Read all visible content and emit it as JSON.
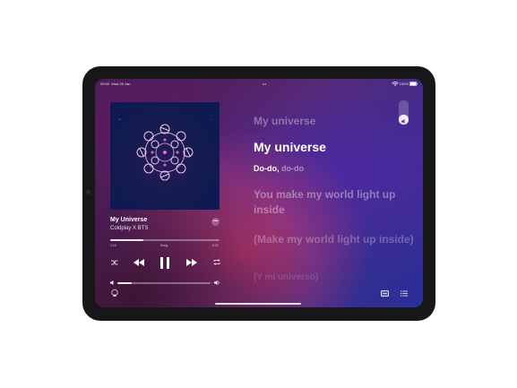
{
  "status_bar": {
    "time": "09:30",
    "date": "Wed 25 Jan",
    "battery": "100%",
    "handle_dots": "•••"
  },
  "now_playing": {
    "title": "My Universe",
    "artist": "Coldplay X BTS",
    "more_label": "•••",
    "progress": 0.3,
    "volume": 0.15,
    "elapsed": "1:12",
    "remaining": "-2:37",
    "badge": "Song"
  },
  "controls": {
    "shuffle": "shuffle-icon",
    "previous": "rewind-icon",
    "playpause": "pause-icon",
    "next": "forward-icon",
    "repeat": "repeat-icon"
  },
  "lyrics": {
    "line1": "My universe",
    "line2": "My universe",
    "line3a": "Do-do,",
    "line3b": "do-do",
    "line4": "You make my world light up inside",
    "line5": "(Make my world light up inside)",
    "line6": "(Y mi universo)"
  },
  "colors": {
    "accent": "#c23a73",
    "deep": "#3a2c8a",
    "text": "#ffffff"
  }
}
